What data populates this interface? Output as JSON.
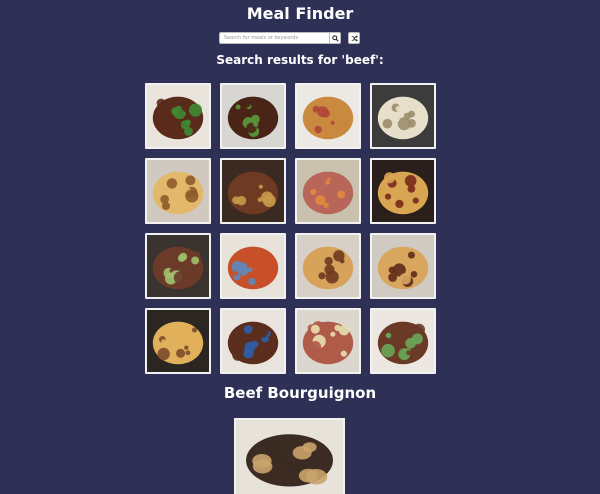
{
  "app": {
    "title": "Meal Finder"
  },
  "search": {
    "placeholder": "Search for meals or keywords",
    "search_icon": "search-icon",
    "random_icon": "shuffle-icon"
  },
  "results": {
    "heading": "Search results for 'beef':",
    "meals": [
      {
        "name": "beef-stir-fry",
        "colors": [
          "#e9e4dc",
          "#5a2a1a",
          "#3f8a34"
        ]
      },
      {
        "name": "beef-onion-stir-fry",
        "colors": [
          "#d8d6d2",
          "#4a2416",
          "#5a9a3a"
        ]
      },
      {
        "name": "beef-wellington",
        "colors": [
          "#ece9e4",
          "#c9893f",
          "#b0473a"
        ]
      },
      {
        "name": "beef-stroganoff",
        "colors": [
          "#3c3c3c",
          "#e7dfc9",
          "#9c8d6a"
        ]
      },
      {
        "name": "beef-pie",
        "colors": [
          "#cfc9c0",
          "#e2b86a",
          "#8d5b2a"
        ]
      },
      {
        "name": "beef-stew-pot",
        "colors": [
          "#3a2a22",
          "#6f3a22",
          "#c99a4a"
        ]
      },
      {
        "name": "roast-beef",
        "colors": [
          "#c9c0ad",
          "#b8655a",
          "#e08a3c"
        ]
      },
      {
        "name": "beef-dumpling-stew",
        "colors": [
          "#2a1f1a",
          "#d8a552",
          "#7a2a1a"
        ]
      },
      {
        "name": "beef-brisket-plate",
        "colors": [
          "#3a3330",
          "#6b3a28",
          "#9ec06a"
        ]
      },
      {
        "name": "beef-potato-stew",
        "colors": [
          "#e7e2da",
          "#c7502a",
          "#5a8bbf"
        ]
      },
      {
        "name": "steak-pie",
        "colors": [
          "#d7d0c6",
          "#d7a25a",
          "#6f3a20"
        ]
      },
      {
        "name": "beef-ale-pie",
        "colors": [
          "#cfcac2",
          "#d9a65e",
          "#5e2c18"
        ]
      },
      {
        "name": "beef-empanadas",
        "colors": [
          "#2b2622",
          "#e0b15a",
          "#7b4d2a"
        ]
      },
      {
        "name": "braised-brisket",
        "colors": [
          "#e9e5de",
          "#5b2d1c",
          "#2e5fa8"
        ]
      },
      {
        "name": "corned-beef-cabbage",
        "colors": [
          "#dcd7ce",
          "#b05a4a",
          "#e8e0b0"
        ]
      },
      {
        "name": "beef-rice-bowl",
        "colors": [
          "#ece8e1",
          "#6a3a26",
          "#6aa85a"
        ]
      }
    ]
  },
  "selected_meal": {
    "title": "Beef Bourguignon",
    "image_colors": [
      "#e8e3da",
      "#3b2b22",
      "#c9a36a"
    ]
  }
}
